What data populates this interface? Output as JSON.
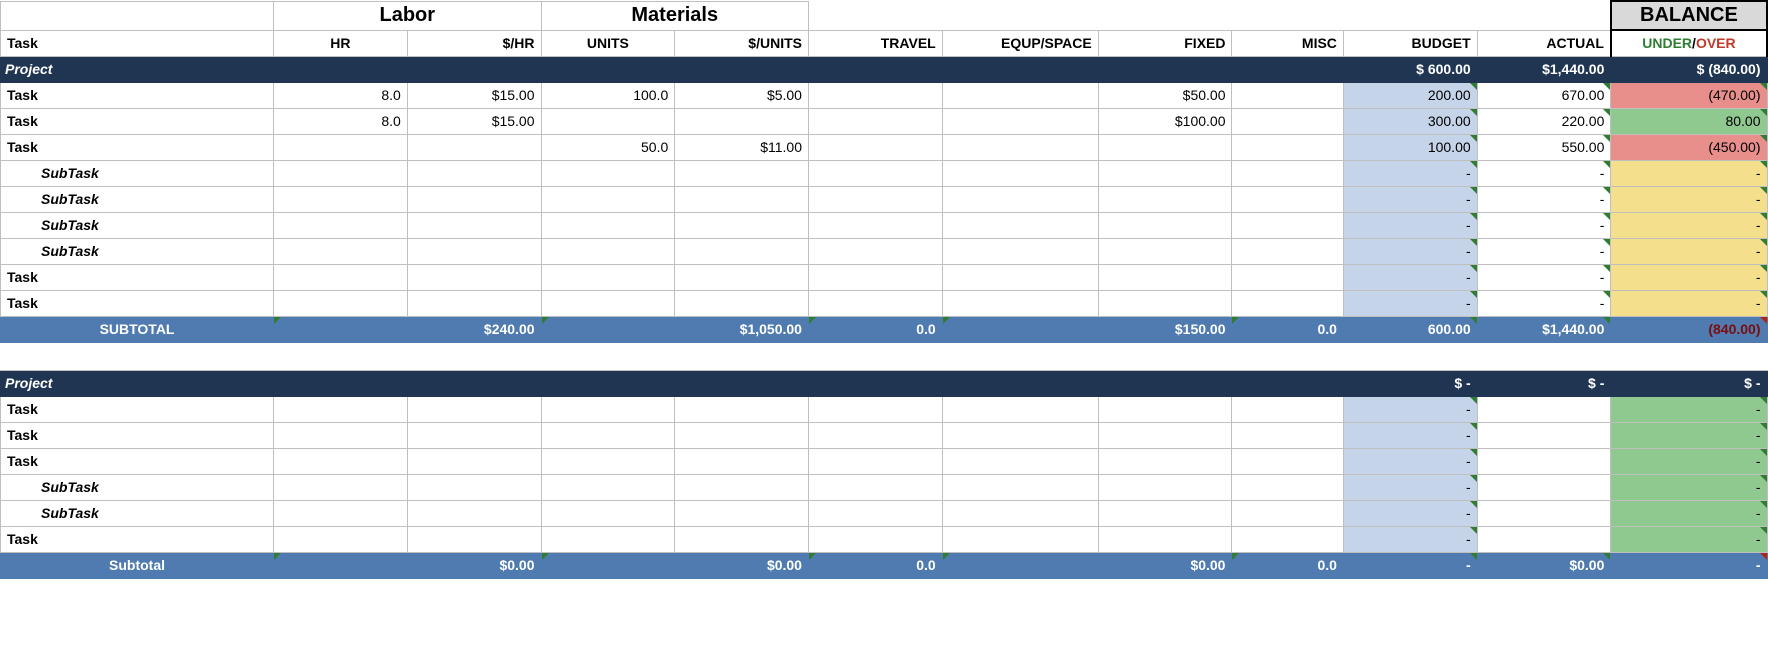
{
  "headers": {
    "task": "Task",
    "labor": "Labor",
    "materials": "Materials",
    "hr": "HR",
    "rate": "$/HR",
    "units": "UNITS",
    "urate": "$/UNITS",
    "travel": "TRAVEL",
    "equip": "EQUP/SPACE",
    "fixed": "FIXED",
    "misc": "MISC",
    "budget": "BUDGET",
    "actual": "ACTUAL",
    "balance": "BALANCE",
    "under": "UNDER",
    "slash": "/",
    "over": "OVER"
  },
  "sections": [
    {
      "project_row": {
        "label": "Project",
        "budget": "$     600.00",
        "actual": "$1,440.00",
        "balance": "$       (840.00)"
      },
      "rows": [
        {
          "type": "task",
          "label": "Task",
          "hr": "8.0",
          "rate": "$15.00",
          "units": "100.0",
          "urate": "$5.00",
          "travel": "",
          "equip": "",
          "fixed": "$50.00",
          "misc": "",
          "budget": "200.00",
          "actual": "670.00",
          "balance": "(470.00)",
          "bal_class": "bal-red"
        },
        {
          "type": "task",
          "label": "Task",
          "hr": "8.0",
          "rate": "$15.00",
          "units": "",
          "urate": "",
          "travel": "",
          "equip": "",
          "fixed": "$100.00",
          "misc": "",
          "budget": "300.00",
          "actual": "220.00",
          "balance": "80.00",
          "bal_class": "bal-green"
        },
        {
          "type": "task",
          "label": "Task",
          "hr": "",
          "rate": "",
          "units": "50.0",
          "urate": "$11.00",
          "travel": "",
          "equip": "",
          "fixed": "",
          "misc": "",
          "budget": "100.00",
          "actual": "550.00",
          "balance": "(450.00)",
          "bal_class": "bal-red"
        },
        {
          "type": "sub",
          "label": "SubTask",
          "hr": "",
          "rate": "",
          "units": "",
          "urate": "",
          "travel": "",
          "equip": "",
          "fixed": "",
          "misc": "",
          "budget": "-",
          "actual": "-",
          "balance": "-",
          "bal_class": "bal-yellow"
        },
        {
          "type": "sub",
          "label": "SubTask",
          "hr": "",
          "rate": "",
          "units": "",
          "urate": "",
          "travel": "",
          "equip": "",
          "fixed": "",
          "misc": "",
          "budget": "-",
          "actual": "-",
          "balance": "-",
          "bal_class": "bal-yellow"
        },
        {
          "type": "sub",
          "label": "SubTask",
          "hr": "",
          "rate": "",
          "units": "",
          "urate": "",
          "travel": "",
          "equip": "",
          "fixed": "",
          "misc": "",
          "budget": "-",
          "actual": "-",
          "balance": "-",
          "bal_class": "bal-yellow"
        },
        {
          "type": "sub",
          "label": "SubTask",
          "hr": "",
          "rate": "",
          "units": "",
          "urate": "",
          "travel": "",
          "equip": "",
          "fixed": "",
          "misc": "",
          "budget": "-",
          "actual": "-",
          "balance": "-",
          "bal_class": "bal-yellow"
        },
        {
          "type": "task",
          "label": "Task",
          "hr": "",
          "rate": "",
          "units": "",
          "urate": "",
          "travel": "",
          "equip": "",
          "fixed": "",
          "misc": "",
          "budget": "-",
          "actual": "-",
          "balance": "-",
          "bal_class": "bal-yellow"
        },
        {
          "type": "task",
          "label": "Task",
          "hr": "",
          "rate": "",
          "units": "",
          "urate": "",
          "travel": "",
          "equip": "",
          "fixed": "",
          "misc": "",
          "budget": "-",
          "actual": "-",
          "balance": "-",
          "bal_class": "bal-yellow"
        }
      ],
      "subtotal": {
        "label": "SUBTOTAL",
        "rate": "$240.00",
        "urate": "$1,050.00",
        "travel": "0.0",
        "fixed": "$150.00",
        "misc": "0.0",
        "budget": "600.00",
        "actual": "$1,440.00",
        "balance": "(840.00)"
      }
    },
    {
      "project_row": {
        "label": "Project",
        "budget": "$         -",
        "actual": "$         -",
        "balance": "$              -"
      },
      "rows": [
        {
          "type": "task",
          "label": "Task",
          "hr": "",
          "rate": "",
          "units": "",
          "urate": "",
          "travel": "",
          "equip": "",
          "fixed": "",
          "misc": "",
          "budget": "-",
          "actual": "",
          "balance": "-",
          "bal_class": "bal-green"
        },
        {
          "type": "task",
          "label": "Task",
          "hr": "",
          "rate": "",
          "units": "",
          "urate": "",
          "travel": "",
          "equip": "",
          "fixed": "",
          "misc": "",
          "budget": "-",
          "actual": "",
          "balance": "-",
          "bal_class": "bal-green"
        },
        {
          "type": "task",
          "label": "Task",
          "hr": "",
          "rate": "",
          "units": "",
          "urate": "",
          "travel": "",
          "equip": "",
          "fixed": "",
          "misc": "",
          "budget": "-",
          "actual": "",
          "balance": "-",
          "bal_class": "bal-green"
        },
        {
          "type": "sub",
          "label": "SubTask",
          "hr": "",
          "rate": "",
          "units": "",
          "urate": "",
          "travel": "",
          "equip": "",
          "fixed": "",
          "misc": "",
          "budget": "-",
          "actual": "",
          "balance": "-",
          "bal_class": "bal-green"
        },
        {
          "type": "sub",
          "label": "SubTask",
          "hr": "",
          "rate": "",
          "units": "",
          "urate": "",
          "travel": "",
          "equip": "",
          "fixed": "",
          "misc": "",
          "budget": "-",
          "actual": "",
          "balance": "-",
          "bal_class": "bal-green"
        },
        {
          "type": "task",
          "label": "Task",
          "hr": "",
          "rate": "",
          "units": "",
          "urate": "",
          "travel": "",
          "equip": "",
          "fixed": "",
          "misc": "",
          "budget": "-",
          "actual": "",
          "balance": "-",
          "bal_class": "bal-green"
        }
      ],
      "subtotal": {
        "label": "Subtotal",
        "rate": "$0.00",
        "urate": "$0.00",
        "travel": "0.0",
        "fixed": "$0.00",
        "misc": "0.0",
        "budget": "-",
        "actual": "$0.00",
        "balance": "-"
      }
    }
  ]
}
